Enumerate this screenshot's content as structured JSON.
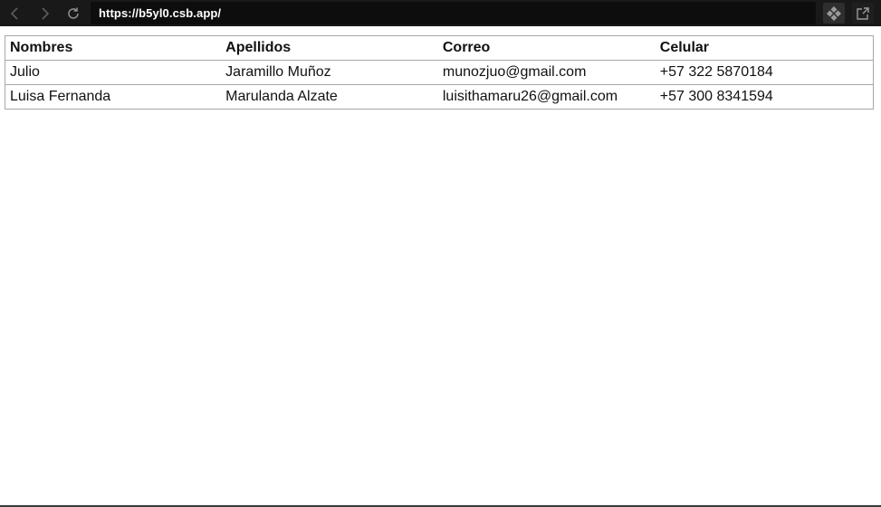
{
  "browser": {
    "url": "https://b5yl0.csb.app/",
    "icons": {
      "back": "chevron-left-icon",
      "forward": "chevron-right-icon",
      "refresh": "refresh-icon",
      "sandbox": "codesandbox-icon",
      "open_window": "external-window-icon"
    }
  },
  "table": {
    "headers": [
      "Nombres",
      "Apellidos",
      "Correo",
      "Celular"
    ],
    "rows": [
      [
        "Julio",
        "Jaramillo Muñoz",
        "munozjuo@gmail.com",
        "+57 322 5870184"
      ],
      [
        "Luisa Fernanda",
        "Marulanda Alzate",
        "luisithamaru26@gmail.com",
        "+57 300 8341594"
      ]
    ]
  }
}
